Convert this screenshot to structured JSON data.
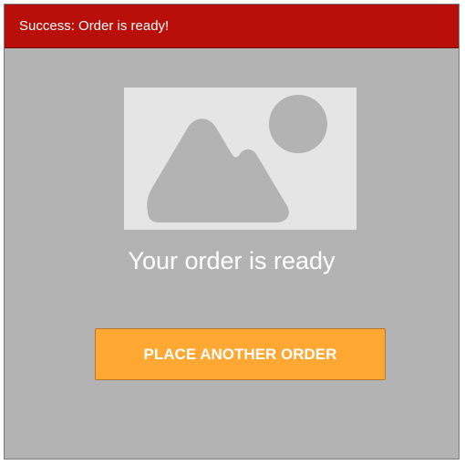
{
  "banner": {
    "text": "Success: Order is ready!",
    "color": "#b80f0a"
  },
  "main": {
    "image_icon": "image-placeholder-icon",
    "message": "Your order is ready",
    "button_label": "PLACE ANOTHER ORDER",
    "button_color": "#ffa733"
  },
  "colors": {
    "panel_background": "#b3b3b3",
    "placeholder_background": "#e5e5e5",
    "placeholder_shape": "#b3b3b3"
  }
}
